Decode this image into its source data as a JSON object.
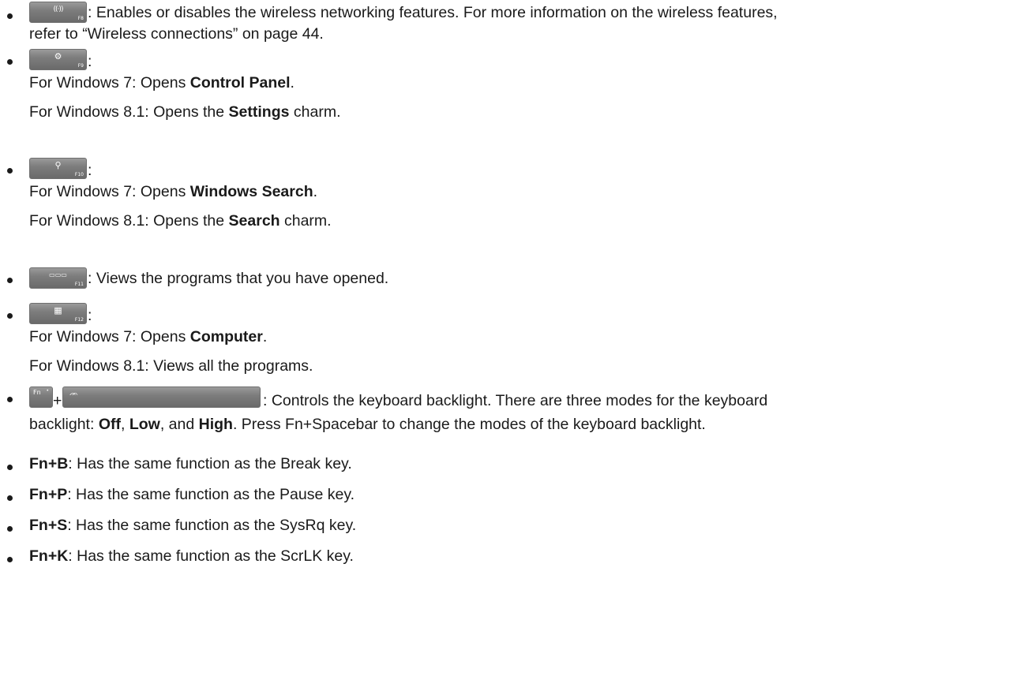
{
  "items": [
    {
      "key": {
        "icon": "wireless-icon",
        "glyph": "((·))",
        "label": "F8"
      },
      "text": ": Enables or disables the wireless networking features. For more information on the wireless features,",
      "text2": "refer to “Wireless connections” on page 44."
    },
    {
      "key": {
        "icon": "gear-icon",
        "glyph": "⚙",
        "label": "F9"
      },
      "suffix": ":",
      "sub1": {
        "pre": "For Windows 7: Opens ",
        "bold": "Control Panel",
        "post": "."
      },
      "sub2": {
        "pre": "For Windows 8.1: Opens the ",
        "bold": "Settings",
        "post": " charm."
      }
    },
    {
      "key": {
        "icon": "search-icon",
        "glyph": "⚲",
        "label": "F10"
      },
      "suffix": ":",
      "sub1": {
        "pre": "For Windows 7: Opens ",
        "bold": "Windows Search",
        "post": "."
      },
      "sub2": {
        "pre": "For Windows 8.1: Opens the ",
        "bold": "Search",
        "post": " charm."
      }
    },
    {
      "key": {
        "icon": "task-view-icon",
        "glyph": "▭▭▭",
        "label": "F11"
      },
      "text": ": Views the programs that you have opened."
    },
    {
      "key": {
        "icon": "all-programs-icon",
        "glyph": "▦",
        "label": "F12"
      },
      "suffix": ":",
      "sub1": {
        "pre": "For Windows 7: Opens ",
        "bold": "Computer",
        "post": "."
      },
      "sub2": {
        "pre": "For Windows 8.1: Views all the programs.",
        "bold": "",
        "post": ""
      }
    },
    {
      "fn_key": {
        "label": "Fn",
        "dot": "•"
      },
      "plus": "+",
      "space_key": {
        "icon": "keyboard-backlight-icon",
        "glyph": "ᨏ"
      },
      "text": ": Controls the keyboard backlight. There are three modes for the keyboard",
      "text2": {
        "pre": "backlight: ",
        "b1": "Off",
        "s1": ", ",
        "b2": "Low",
        "s2": ", and ",
        "b3": "High",
        "post": ". Press Fn+Spacebar to change the modes of the keyboard backlight."
      }
    },
    {
      "bold": "Fn+B",
      "text": ": Has the same function as the Break key."
    },
    {
      "bold": "Fn+P",
      "text": ": Has the same function as the Pause key."
    },
    {
      "bold": "Fn+S",
      "text": ": Has the same function as the SysRq key."
    },
    {
      "bold": "Fn+K",
      "text": ": Has the same function as the ScrLK key."
    }
  ]
}
